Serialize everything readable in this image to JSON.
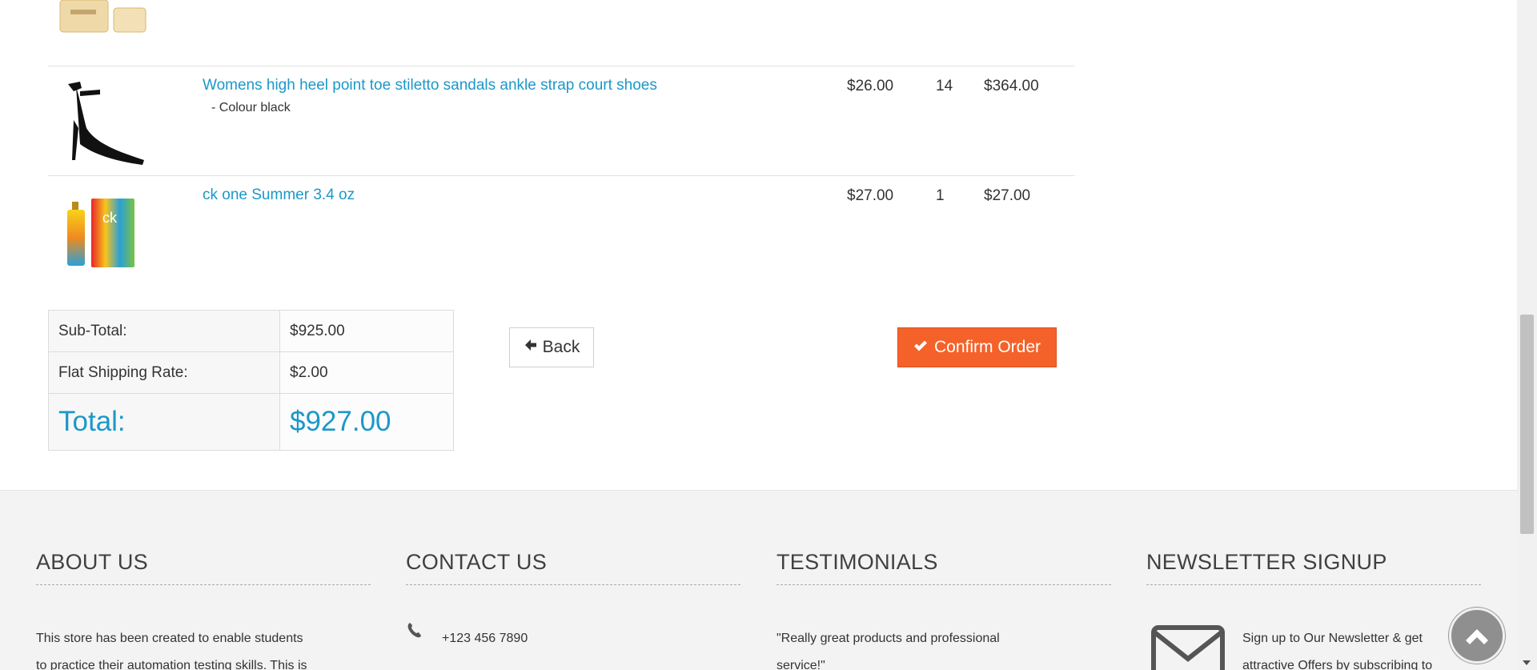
{
  "products": [
    {
      "name": "Womens high heel point toe stiletto sandals ankle strap court shoes",
      "option": "- Colour black",
      "price": "$26.00",
      "quantity": "14",
      "total": "$364.00"
    },
    {
      "name": "ck one Summer 3.4 oz",
      "price": "$27.00",
      "quantity": "1",
      "total": "$27.00"
    }
  ],
  "totals": {
    "subtotal_label": "Sub-Total:",
    "subtotal_value": "$925.00",
    "shipping_label": "Flat Shipping Rate:",
    "shipping_value": "$2.00",
    "total_label": "Total:",
    "total_value": "$927.00"
  },
  "actions": {
    "back_label": "Back",
    "confirm_label": "Confirm Order"
  },
  "footer": {
    "about": {
      "heading": "ABOUT US",
      "text_line1": "This store has been created to enable students",
      "text_line2": "to practice their automation testing skills. This is"
    },
    "contact": {
      "heading": "CONTACT US",
      "phone": "+123 456 7890"
    },
    "testimonials": {
      "heading": "TESTIMONIALS",
      "quote_line1": "\"Really great products and professional",
      "quote_line2": "service!\""
    },
    "newsletter": {
      "heading": "NEWSLETTER SIGNUP",
      "text_line1": "Sign up to Our Newsletter & get",
      "text_line2": "attractive Offers by subscribing to"
    }
  },
  "colors": {
    "link": "#1b98c8",
    "confirm_button": "#f4622a",
    "footer_bg": "#f3f3f3"
  },
  "icons": [
    "arrow-left-icon",
    "check-icon",
    "phone-icon",
    "envelope-icon",
    "chevron-up-icon"
  ]
}
